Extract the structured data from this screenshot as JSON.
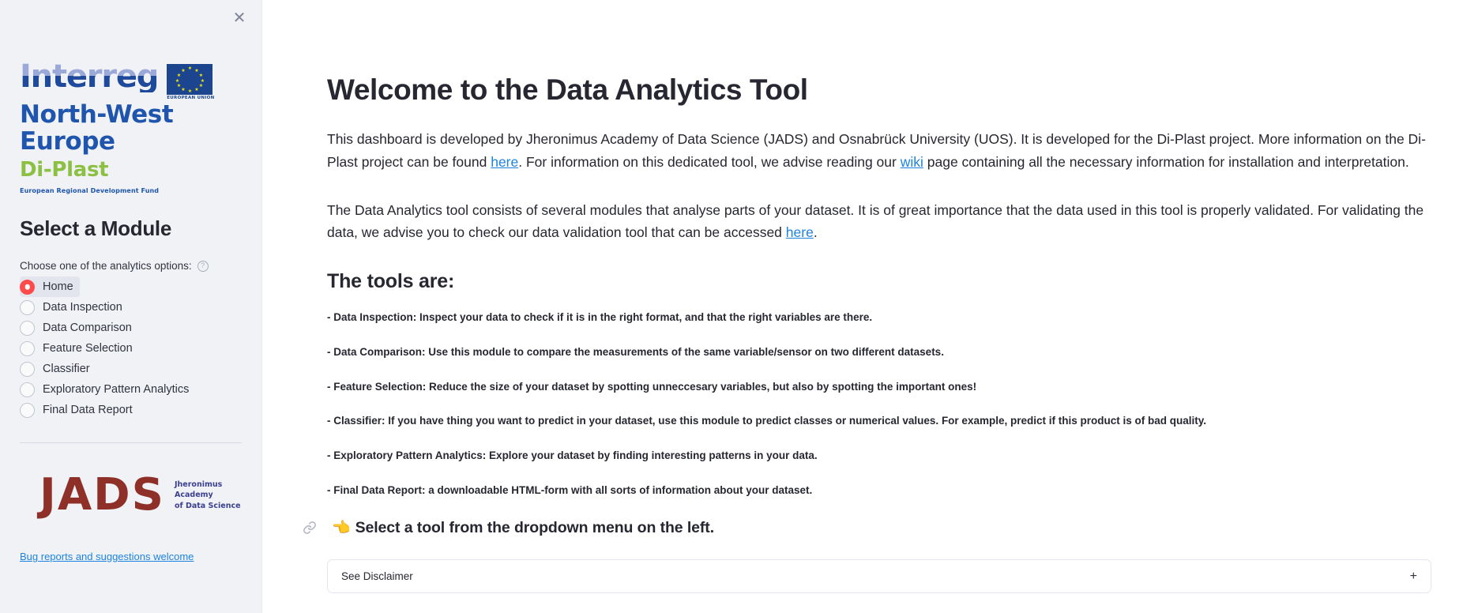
{
  "sidebar": {
    "close_icon": "close-icon",
    "logo": {
      "interreg": "Interreg",
      "region": "North-West Europe",
      "project": "Di-Plast",
      "fund": "European Regional Development Fund",
      "eu_caption": "EUROPEAN UNION"
    },
    "module_title": "Select a Module",
    "choose_label": "Choose one of the analytics options:",
    "help_icon": "?",
    "options": [
      {
        "label": "Home",
        "selected": true
      },
      {
        "label": "Data Inspection",
        "selected": false
      },
      {
        "label": "Data Comparison",
        "selected": false
      },
      {
        "label": "Feature Selection",
        "selected": false
      },
      {
        "label": "Classifier",
        "selected": false
      },
      {
        "label": "Exploratory Pattern Analytics",
        "selected": false
      },
      {
        "label": "Final Data Report",
        "selected": false
      }
    ],
    "jads": {
      "mark": "JADS",
      "line1": "Jheronimus",
      "line2": "Academy",
      "line3": "of Data Science"
    },
    "bug_link": "Bug reports and suggestions welcome"
  },
  "main": {
    "title": "Welcome to the Data Analytics Tool",
    "intro_p1_a": "This dashboard is developed by Jheronimus Academy of Data Science (JADS) and Osnabrück University (UOS). It is developed for the Di-Plast project. More information on the Di-Plast project can be found ",
    "intro_p1_link1": "here",
    "intro_p1_b": ". For information on this dedicated tool, we advise reading our ",
    "intro_p1_link2": "wiki",
    "intro_p1_c": " page containing all the necessary information for installation and interpretation.",
    "intro_p2_a": "The Data Analytics tool consists of several modules that analyse parts of your dataset. It is of great importance that the data used in this tool is properly validated. For validating the data, we advise you to check our data validation tool that can be accessed ",
    "intro_p2_link": "here",
    "intro_p2_b": ".",
    "tools_heading": "The tools are:",
    "tools": [
      "- Data Inspection: Inspect your data to check if it is in the right format, and that the right variables are there.",
      "- Data Comparison: Use this module to compare the measurements of the same variable/sensor on two different datasets.",
      "- Feature Selection: Reduce the size of your dataset by spotting unneccesary variables, but also by spotting the important ones!",
      "- Classifier: If you have thing you want to predict in your dataset, use this module to predict classes or numerical values. For example, predict if this product is of bad quality.",
      "- Exploratory Pattern Analytics: Explore your dataset by finding interesting patterns in your data.",
      "- Final Data Report: a downloadable HTML-form with all sorts of information about your dataset."
    ],
    "cta_hand": "👈",
    "cta_text": "Select a tool from the dropdown menu on the left.",
    "anchor_icon": "link-icon",
    "expander_label": "See Disclaimer",
    "expander_plus": "+"
  },
  "colors": {
    "accent_red": "#ff4b4b",
    "link_blue": "#1c83e1",
    "sidebar_bg": "#f0f2f6",
    "interreg_blue": "#1f4a9c",
    "diplast_green": "#8cc043",
    "jads_maroon": "#8e2f28"
  }
}
